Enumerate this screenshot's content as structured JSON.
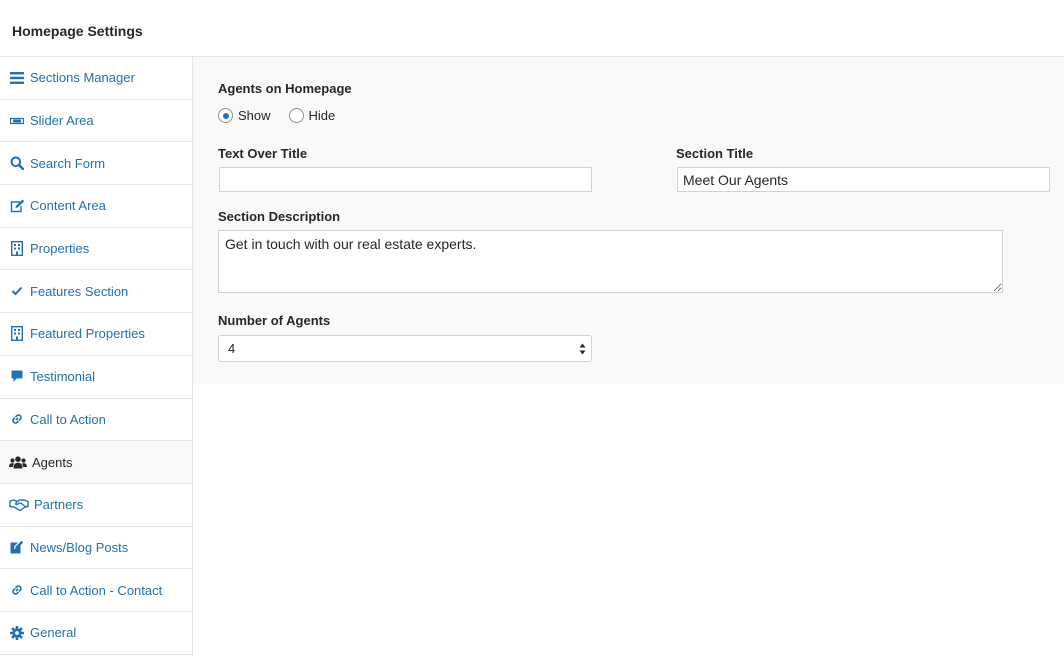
{
  "header": {
    "title": "Homepage Settings"
  },
  "sidebar": {
    "items": [
      {
        "label": "Sections Manager"
      },
      {
        "label": "Slider Area"
      },
      {
        "label": "Search Form"
      },
      {
        "label": "Content Area"
      },
      {
        "label": "Properties"
      },
      {
        "label": "Features Section"
      },
      {
        "label": "Featured Properties"
      },
      {
        "label": "Testimonial"
      },
      {
        "label": "Call to Action"
      },
      {
        "label": "Agents",
        "active": true
      },
      {
        "label": "Partners"
      },
      {
        "label": "News/Blog Posts"
      },
      {
        "label": "Call to Action - Contact"
      },
      {
        "label": "General"
      }
    ]
  },
  "form": {
    "agents_on_homepage": {
      "label": "Agents on Homepage",
      "options": [
        "Show",
        "Hide"
      ],
      "selected": "Show"
    },
    "text_over_title": {
      "label": "Text Over Title",
      "value": ""
    },
    "section_title": {
      "label": "Section Title",
      "value": "Meet Our Agents"
    },
    "section_description": {
      "label": "Section Description",
      "value": "Get in touch with our real estate experts."
    },
    "number_of_agents": {
      "label": "Number of Agents",
      "value": "4"
    }
  },
  "colors": {
    "link": "#2271b1",
    "text": "#23282d",
    "border": "#e5e5e5",
    "panel": "#f9f9f9"
  }
}
